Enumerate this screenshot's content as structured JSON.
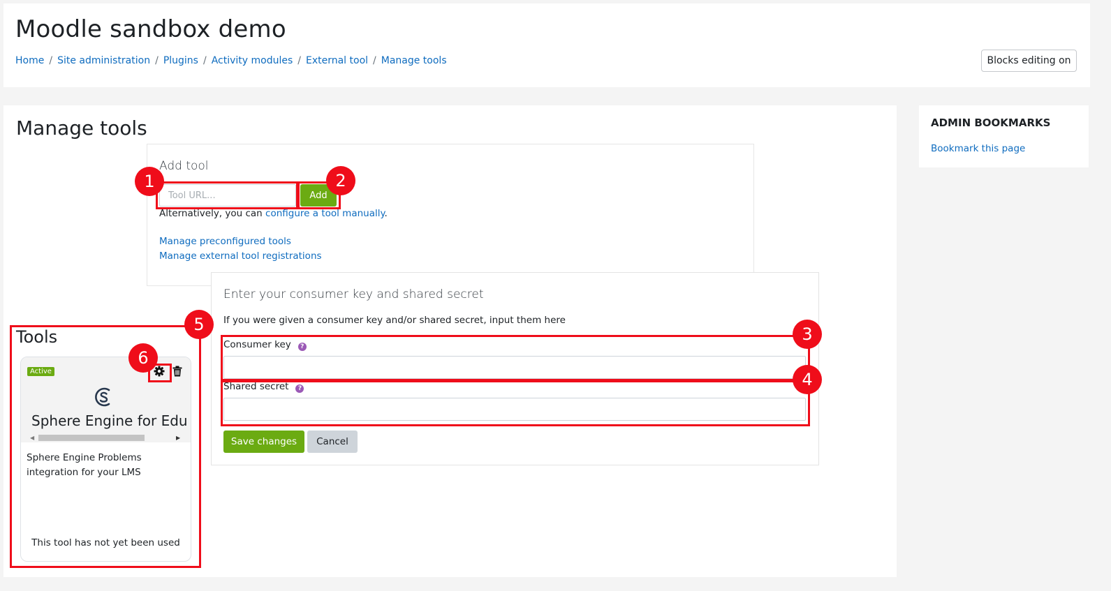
{
  "header": {
    "site_title": "Moodle sandbox demo",
    "breadcrumb": [
      "Home",
      "Site administration",
      "Plugins",
      "Activity modules",
      "External tool",
      "Manage tools"
    ],
    "blocks_editing_label": "Blocks editing on"
  },
  "main": {
    "heading": "Manage tools",
    "add_tool": {
      "title": "Add tool",
      "url_placeholder": "Tool URL...",
      "add_label": "Add",
      "alt_prefix": "Alternatively, you can ",
      "alt_link": "configure a tool manually",
      "alt_suffix": ".",
      "manage_preconfigured": "Manage preconfigured tools",
      "manage_registrations": "Manage external tool registrations"
    },
    "consumer": {
      "title": "Enter your consumer key and shared secret",
      "description": "If you were given a consumer key and/or shared secret, input them here",
      "key_label": "Consumer key",
      "secret_label": "Shared secret",
      "save_label": "Save changes",
      "cancel_label": "Cancel"
    },
    "tools": {
      "heading": "Tools",
      "card": {
        "status": "Active",
        "name": "Sphere Engine for Education",
        "description": "Sphere Engine Problems integration for your LMS",
        "usage": "This tool has not yet been used"
      }
    }
  },
  "sidebar": {
    "block_title": "ADMIN BOOKMARKS",
    "bookmark_link": "Bookmark this page"
  },
  "annotations": [
    "1",
    "2",
    "3",
    "4",
    "5",
    "6"
  ],
  "colors": {
    "accent_green": "#6bab12",
    "link_blue": "#0f6cbf",
    "annotation_red": "#ef0d1a",
    "help_purple": "#9b59b6"
  },
  "icons": [
    "gear-icon",
    "trash-icon",
    "help-icon",
    "tool-logo-icon",
    "scroll-left-icon",
    "scroll-right-icon"
  ]
}
